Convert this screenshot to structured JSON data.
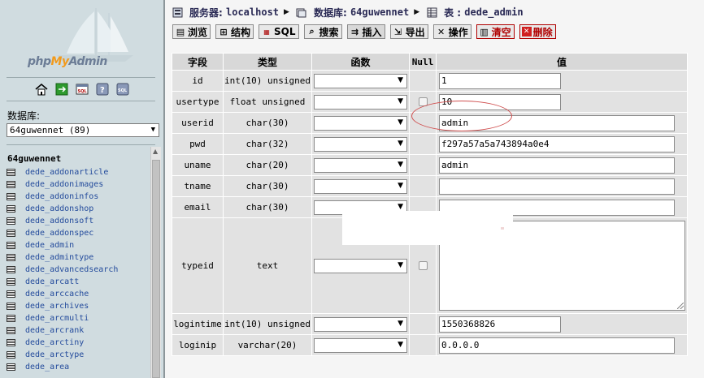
{
  "sidebar": {
    "logo": {
      "php": "php",
      "my": "My",
      "admin": "Admin"
    },
    "icons": [
      "home-icon",
      "exit-icon",
      "sql-icon",
      "help-icon",
      "docs-icon"
    ],
    "db_label": "数据库:",
    "db_select": "64guwennet (89)",
    "db_name": "64guwennet",
    "tables": [
      "dede_addonarticle",
      "dede_addonimages",
      "dede_addoninfos",
      "dede_addonshop",
      "dede_addonsoft",
      "dede_addonspec",
      "dede_admin",
      "dede_admintype",
      "dede_advancedsearch",
      "dede_arcatt",
      "dede_arccache",
      "dede_archives",
      "dede_arcmulti",
      "dede_arcrank",
      "dede_arctiny",
      "dede_arctype",
      "dede_area"
    ]
  },
  "breadcrumb": {
    "server_label": "服务器:",
    "server": "localhost",
    "database_label": "数据库:",
    "database": "64guwennet",
    "table_label": "表 :",
    "table": "dede_admin"
  },
  "tabs": [
    {
      "label": "浏览",
      "icon": "browse-icon"
    },
    {
      "label": "结构",
      "icon": "structure-icon"
    },
    {
      "label": "SQL",
      "icon": "sql-icon"
    },
    {
      "label": "搜索",
      "icon": "search-icon"
    },
    {
      "label": "插入",
      "icon": "insert-icon"
    },
    {
      "label": "导出",
      "icon": "export-icon"
    },
    {
      "label": "操作",
      "icon": "operations-icon"
    },
    {
      "label": "清空",
      "icon": "empty-icon"
    },
    {
      "label": "删除",
      "icon": "drop-icon"
    }
  ],
  "table_headers": {
    "field": "字段",
    "type": "类型",
    "function": "函数",
    "null": "Null",
    "value": "值"
  },
  "rows": [
    {
      "field": "id",
      "type": "int(10) unsigned",
      "null_checkbox": false,
      "value": "1",
      "input": "short"
    },
    {
      "field": "usertype",
      "type": "float unsigned",
      "null_checkbox": true,
      "value": "10",
      "input": "short"
    },
    {
      "field": "userid",
      "type": "char(30)",
      "null_checkbox": false,
      "value": "admin",
      "input": "long"
    },
    {
      "field": "pwd",
      "type": "char(32)",
      "null_checkbox": false,
      "value": "f297a57a5a743894a0e4",
      "input": "long"
    },
    {
      "field": "uname",
      "type": "char(20)",
      "null_checkbox": false,
      "value": "admin",
      "input": "long"
    },
    {
      "field": "tname",
      "type": "char(30)",
      "null_checkbox": false,
      "value": "",
      "input": "long"
    },
    {
      "field": "email",
      "type": "char(30)",
      "null_checkbox": false,
      "value": "",
      "input": "long"
    },
    {
      "field": "typeid",
      "type": "text",
      "null_checkbox": true,
      "value": "",
      "input": "textarea"
    },
    {
      "field": "logintime",
      "type": "int(10) unsigned",
      "null_checkbox": false,
      "value": "1550368826",
      "input": "short"
    },
    {
      "field": "loginip",
      "type": "varchar(20)",
      "null_checkbox": false,
      "value": "0.0.0.0",
      "input": "long"
    }
  ],
  "colors": {
    "sidebar_bg": "#d0dce0",
    "header_bg": "#d8d8d8",
    "cell_bg": "#e2e2e2",
    "link": "#234b9c",
    "annotation": "#d05050"
  }
}
